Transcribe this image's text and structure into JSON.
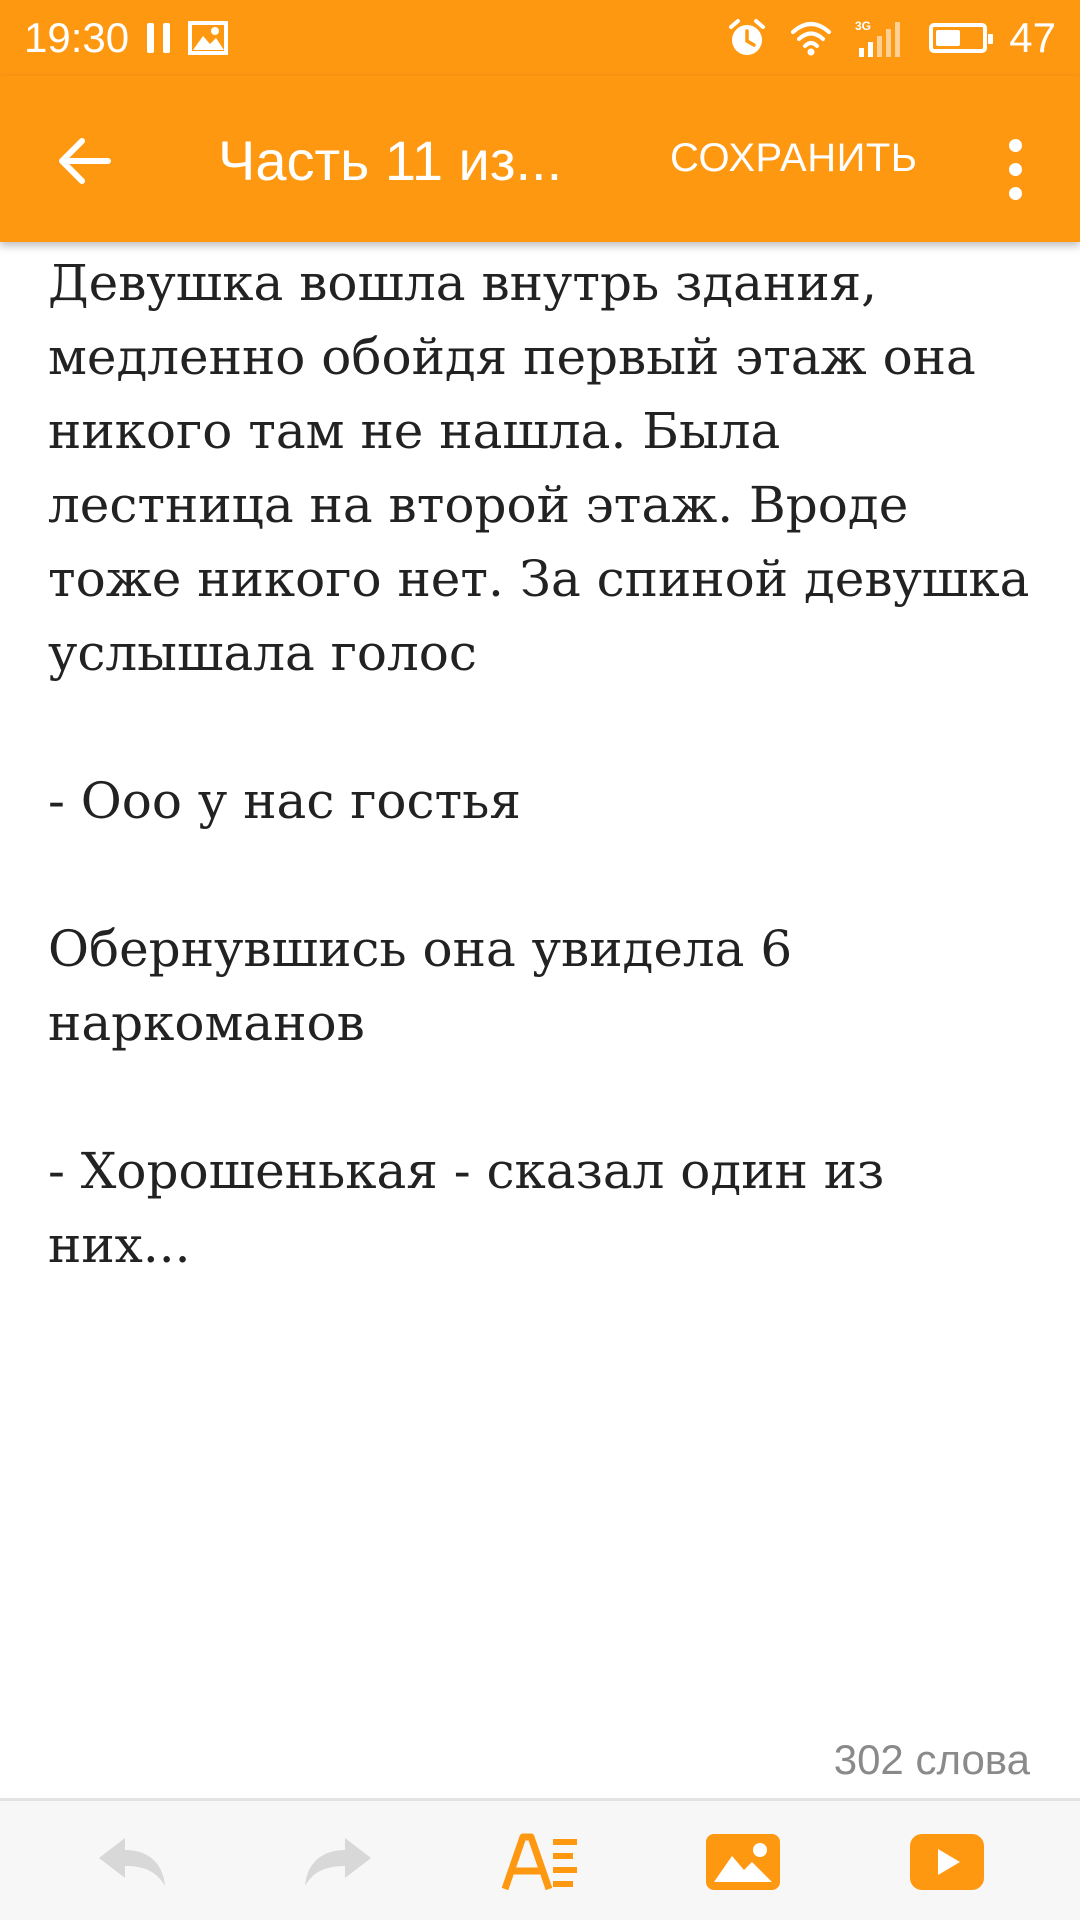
{
  "status_bar": {
    "time": "19:30",
    "battery": "47",
    "network": "3G"
  },
  "app_bar": {
    "title": "Часть 11 из...",
    "save_label": "СОХРАНИТЬ"
  },
  "editor": {
    "paragraphs": [
      "Девушка вошла внутрь здания, медленно обойдя первый этаж она никого там не нашла. Была лестница на второй этаж. Вроде тоже никого нет. За спиной девушка услышала голос",
      "- Ооо у нас гостья",
      "Обернувшись она увидела 6 наркоманов",
      "- Хорошенькая - сказал один из них..."
    ]
  },
  "footer": {
    "word_count": "302 слова"
  },
  "toolbar": {
    "icons": [
      "undo-icon",
      "redo-icon",
      "text-format-icon",
      "insert-image-icon",
      "insert-video-icon"
    ]
  },
  "colors": {
    "accent": "#ff9811",
    "text": "#222222",
    "muted": "#8a8a8a",
    "disabled_icon": "#d8d8d8"
  }
}
